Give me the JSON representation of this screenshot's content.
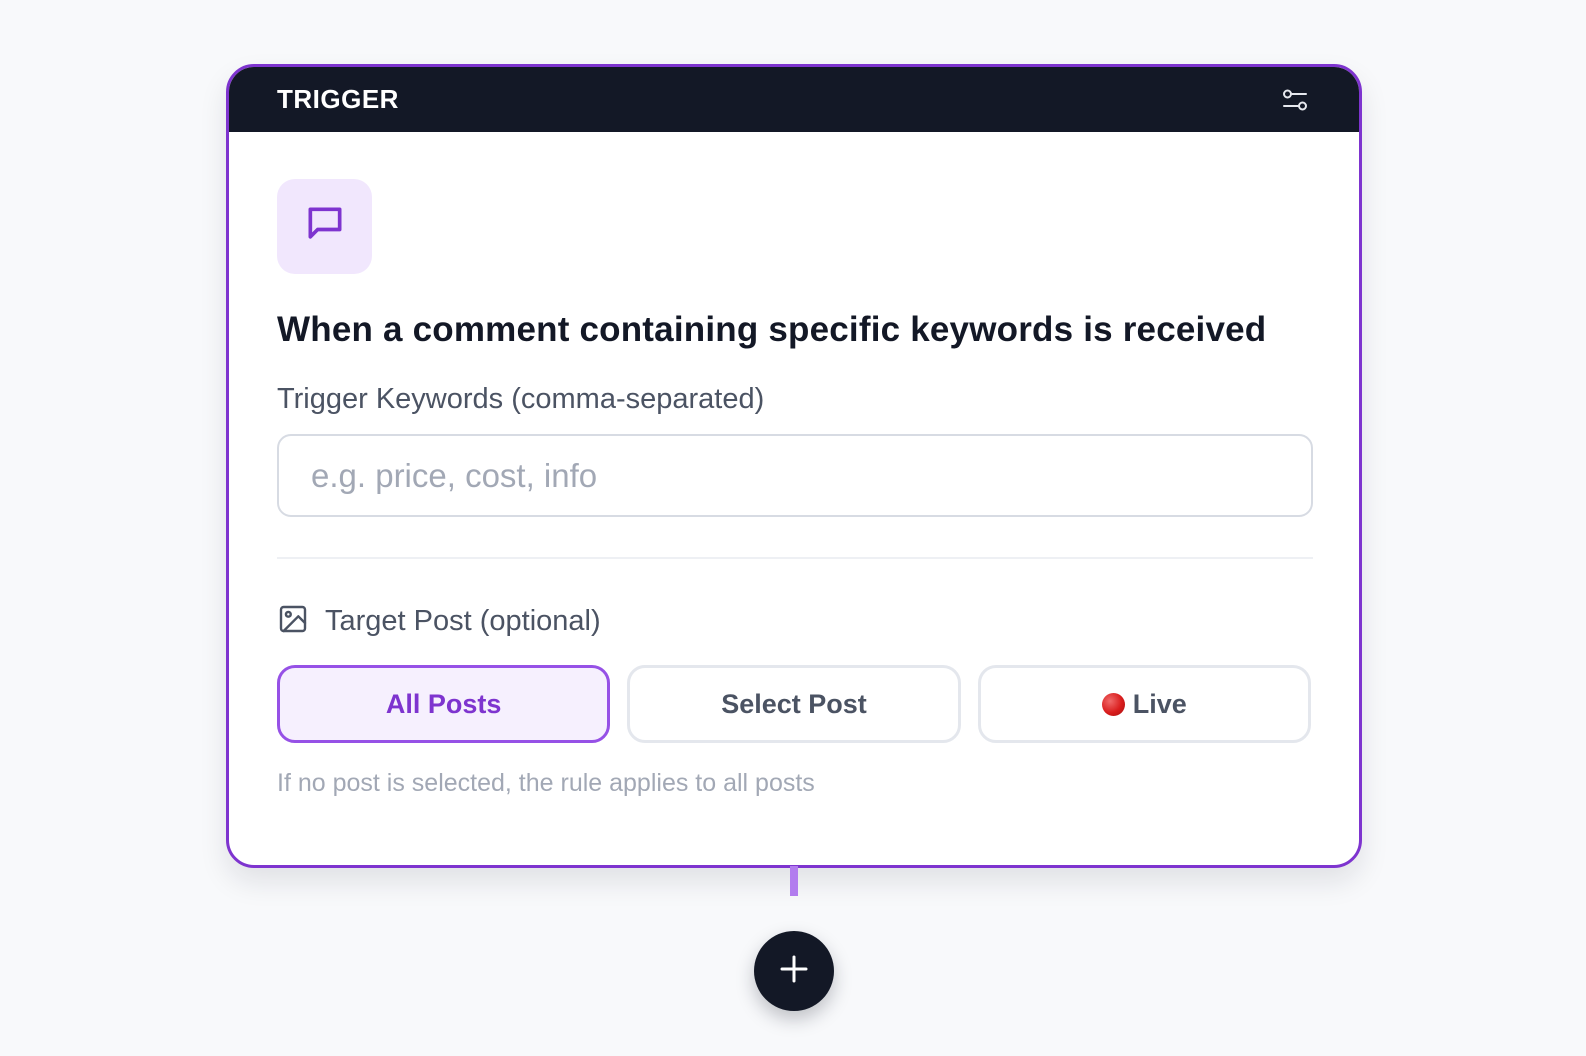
{
  "trigger": {
    "header_title": "TRIGGER",
    "header_icon": "sliders-icon",
    "type_icon": "message-square-icon",
    "heading": "When a comment containing specific keywords is received",
    "keywords": {
      "label": "Trigger Keywords (comma-separated)",
      "value": "",
      "placeholder": "e.g. price, cost, info"
    },
    "target_post": {
      "icon": "image-icon",
      "label": "Target Post (optional)",
      "options": [
        {
          "label": "All Posts",
          "selected": true
        },
        {
          "label": "Select Post",
          "selected": false
        },
        {
          "label": "Live",
          "selected": false,
          "icon": "red-circle-icon"
        }
      ],
      "hint": "If no post is selected, the rule applies to all posts"
    }
  },
  "add_step": {
    "icon": "plus-icon"
  },
  "colors": {
    "accent": "#7e34cf",
    "accent_light": "#f1e7fd",
    "header_bg": "#131826",
    "page_bg": "#f8f9fb",
    "live_red": "#d91d1d"
  }
}
